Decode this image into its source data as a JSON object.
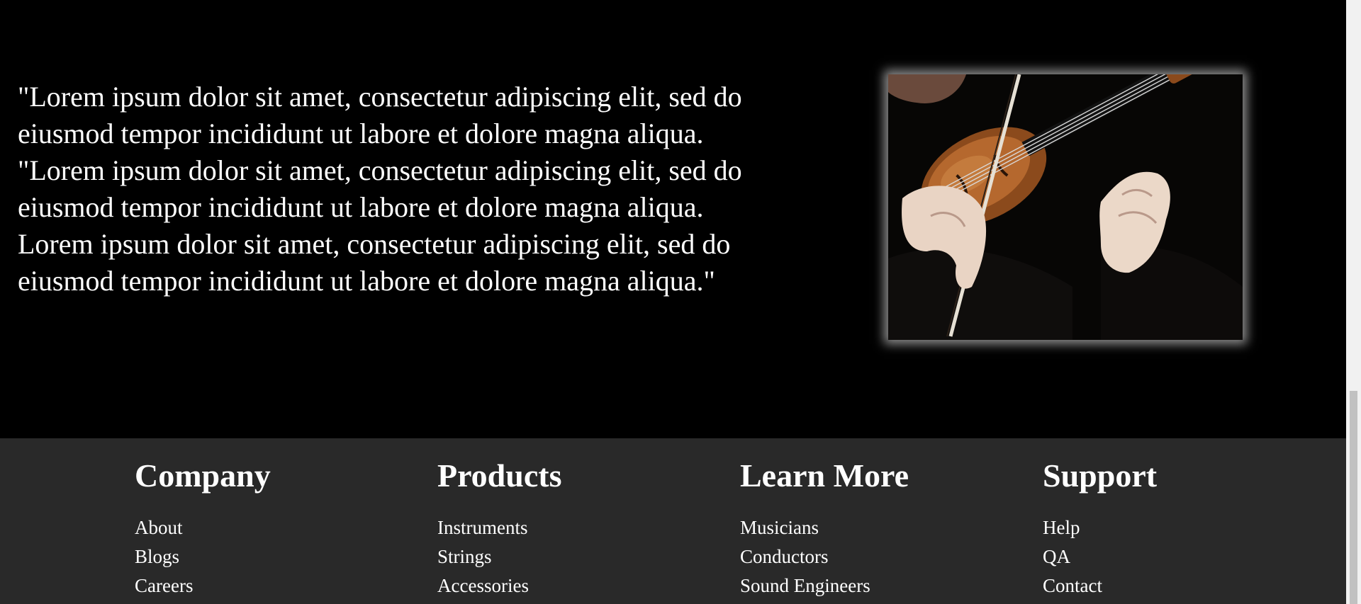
{
  "main": {
    "quote": "\"Lorem ipsum dolor sit amet, consectetur adipiscing elit, sed do eiusmod tempor incididunt ut labore et dolore magna aliqua. \"Lorem ipsum dolor sit amet, consectetur adipiscing elit, sed do eiusmod tempor incididunt ut labore et dolore magna aliqua. Lorem ipsum dolor sit amet, consectetur adipiscing elit, sed do eiusmod tempor incididunt ut labore et dolore magna aliqua.\"",
    "photo_subject": "violinist-photo"
  },
  "footer": {
    "columns": [
      {
        "heading": "Company",
        "links": [
          "About",
          "Blogs",
          "Careers"
        ]
      },
      {
        "heading": "Products",
        "links": [
          "Instruments",
          "Strings",
          "Accessories"
        ]
      },
      {
        "heading": "Learn More",
        "links": [
          "Musicians",
          "Conductors",
          "Sound Engineers"
        ]
      },
      {
        "heading": "Support",
        "links": [
          "Help",
          "QA",
          "Contact"
        ]
      }
    ]
  },
  "colors": {
    "page_background": "#000000",
    "footer_background": "#292929",
    "text": "#ffffff"
  }
}
